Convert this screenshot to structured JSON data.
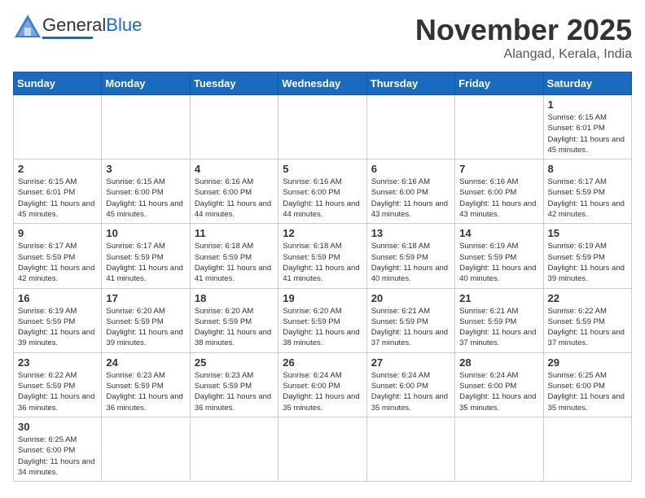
{
  "header": {
    "logo_general": "General",
    "logo_blue": "Blue",
    "month_title": "November 2025",
    "location": "Alangad, Kerala, India"
  },
  "days_of_week": [
    "Sunday",
    "Monday",
    "Tuesday",
    "Wednesday",
    "Thursday",
    "Friday",
    "Saturday"
  ],
  "weeks": [
    [
      {
        "day": "",
        "info": ""
      },
      {
        "day": "",
        "info": ""
      },
      {
        "day": "",
        "info": ""
      },
      {
        "day": "",
        "info": ""
      },
      {
        "day": "",
        "info": ""
      },
      {
        "day": "",
        "info": ""
      },
      {
        "day": "1",
        "info": "Sunrise: 6:15 AM\nSunset: 6:01 PM\nDaylight: 11 hours\nand 45 minutes."
      }
    ],
    [
      {
        "day": "2",
        "info": "Sunrise: 6:15 AM\nSunset: 6:01 PM\nDaylight: 11 hours\nand 45 minutes."
      },
      {
        "day": "3",
        "info": "Sunrise: 6:15 AM\nSunset: 6:00 PM\nDaylight: 11 hours\nand 45 minutes."
      },
      {
        "day": "4",
        "info": "Sunrise: 6:16 AM\nSunset: 6:00 PM\nDaylight: 11 hours\nand 44 minutes."
      },
      {
        "day": "5",
        "info": "Sunrise: 6:16 AM\nSunset: 6:00 PM\nDaylight: 11 hours\nand 44 minutes."
      },
      {
        "day": "6",
        "info": "Sunrise: 6:16 AM\nSunset: 6:00 PM\nDaylight: 11 hours\nand 43 minutes."
      },
      {
        "day": "7",
        "info": "Sunrise: 6:16 AM\nSunset: 6:00 PM\nDaylight: 11 hours\nand 43 minutes."
      },
      {
        "day": "8",
        "info": "Sunrise: 6:17 AM\nSunset: 5:59 PM\nDaylight: 11 hours\nand 42 minutes."
      }
    ],
    [
      {
        "day": "9",
        "info": "Sunrise: 6:17 AM\nSunset: 5:59 PM\nDaylight: 11 hours\nand 42 minutes."
      },
      {
        "day": "10",
        "info": "Sunrise: 6:17 AM\nSunset: 5:59 PM\nDaylight: 11 hours\nand 41 minutes."
      },
      {
        "day": "11",
        "info": "Sunrise: 6:18 AM\nSunset: 5:59 PM\nDaylight: 11 hours\nand 41 minutes."
      },
      {
        "day": "12",
        "info": "Sunrise: 6:18 AM\nSunset: 5:59 PM\nDaylight: 11 hours\nand 41 minutes."
      },
      {
        "day": "13",
        "info": "Sunrise: 6:18 AM\nSunset: 5:59 PM\nDaylight: 11 hours\nand 40 minutes."
      },
      {
        "day": "14",
        "info": "Sunrise: 6:19 AM\nSunset: 5:59 PM\nDaylight: 11 hours\nand 40 minutes."
      },
      {
        "day": "15",
        "info": "Sunrise: 6:19 AM\nSunset: 5:59 PM\nDaylight: 11 hours\nand 39 minutes."
      }
    ],
    [
      {
        "day": "16",
        "info": "Sunrise: 6:19 AM\nSunset: 5:59 PM\nDaylight: 11 hours\nand 39 minutes."
      },
      {
        "day": "17",
        "info": "Sunrise: 6:20 AM\nSunset: 5:59 PM\nDaylight: 11 hours\nand 39 minutes."
      },
      {
        "day": "18",
        "info": "Sunrise: 6:20 AM\nSunset: 5:59 PM\nDaylight: 11 hours\nand 38 minutes."
      },
      {
        "day": "19",
        "info": "Sunrise: 6:20 AM\nSunset: 5:59 PM\nDaylight: 11 hours\nand 38 minutes."
      },
      {
        "day": "20",
        "info": "Sunrise: 6:21 AM\nSunset: 5:59 PM\nDaylight: 11 hours\nand 37 minutes."
      },
      {
        "day": "21",
        "info": "Sunrise: 6:21 AM\nSunset: 5:59 PM\nDaylight: 11 hours\nand 37 minutes."
      },
      {
        "day": "22",
        "info": "Sunrise: 6:22 AM\nSunset: 5:59 PM\nDaylight: 11 hours\nand 37 minutes."
      }
    ],
    [
      {
        "day": "23",
        "info": "Sunrise: 6:22 AM\nSunset: 5:59 PM\nDaylight: 11 hours\nand 36 minutes."
      },
      {
        "day": "24",
        "info": "Sunrise: 6:23 AM\nSunset: 5:59 PM\nDaylight: 11 hours\nand 36 minutes."
      },
      {
        "day": "25",
        "info": "Sunrise: 6:23 AM\nSunset: 5:59 PM\nDaylight: 11 hours\nand 36 minutes."
      },
      {
        "day": "26",
        "info": "Sunrise: 6:24 AM\nSunset: 6:00 PM\nDaylight: 11 hours\nand 35 minutes."
      },
      {
        "day": "27",
        "info": "Sunrise: 6:24 AM\nSunset: 6:00 PM\nDaylight: 11 hours\nand 35 minutes."
      },
      {
        "day": "28",
        "info": "Sunrise: 6:24 AM\nSunset: 6:00 PM\nDaylight: 11 hours\nand 35 minutes."
      },
      {
        "day": "29",
        "info": "Sunrise: 6:25 AM\nSunset: 6:00 PM\nDaylight: 11 hours\nand 35 minutes."
      }
    ],
    [
      {
        "day": "30",
        "info": "Sunrise: 6:25 AM\nSunset: 6:00 PM\nDaylight: 11 hours\nand 34 minutes."
      },
      {
        "day": "",
        "info": ""
      },
      {
        "day": "",
        "info": ""
      },
      {
        "day": "",
        "info": ""
      },
      {
        "day": "",
        "info": ""
      },
      {
        "day": "",
        "info": ""
      },
      {
        "day": "",
        "info": ""
      }
    ]
  ]
}
